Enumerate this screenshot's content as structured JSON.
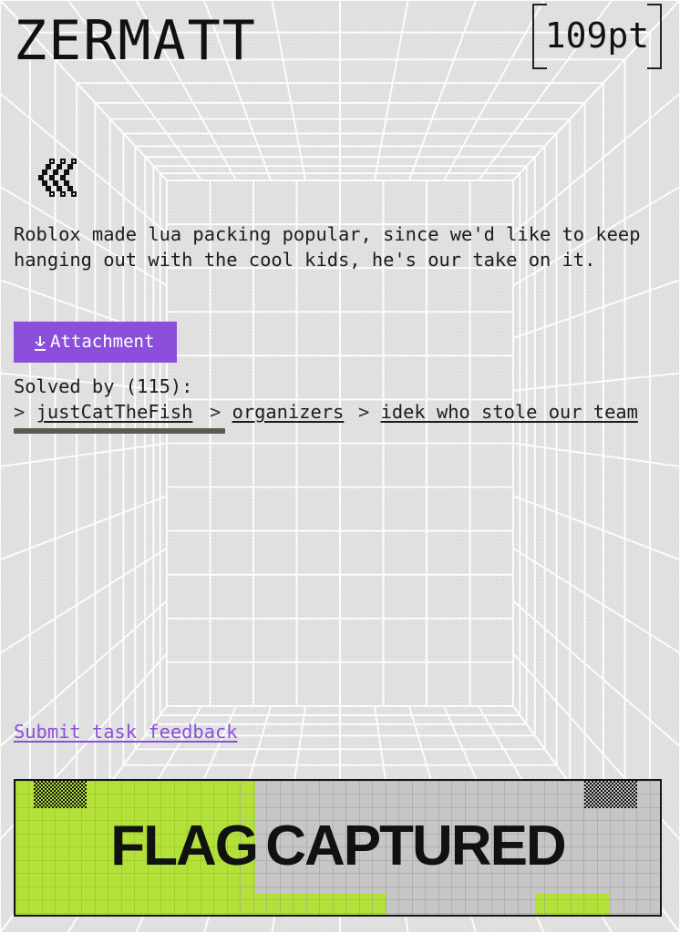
{
  "challenge": {
    "title": "ZERMATT",
    "points": "109pt",
    "description": "Roblox made lua packing popular, since we'd like to keep hanging out with the cool kids, he's our take on it."
  },
  "nav": {
    "back_icon": "double-chevron-left-icon"
  },
  "attachment": {
    "label": "Attachment",
    "icon": "download-icon"
  },
  "solves": {
    "label": "Solved by (115):",
    "chevron": ">",
    "teams": [
      "justCatTheFish",
      "organizers",
      "idek who stole our team"
    ]
  },
  "feedback": {
    "label": "Submit task feedback"
  },
  "status": {
    "text": "FLAG CAPTURED"
  },
  "colors": {
    "accent": "#8b4fdc",
    "flag_green": "#b4e03a",
    "flag_gray": "#c6c6c6",
    "background": "#e3e3e3"
  }
}
